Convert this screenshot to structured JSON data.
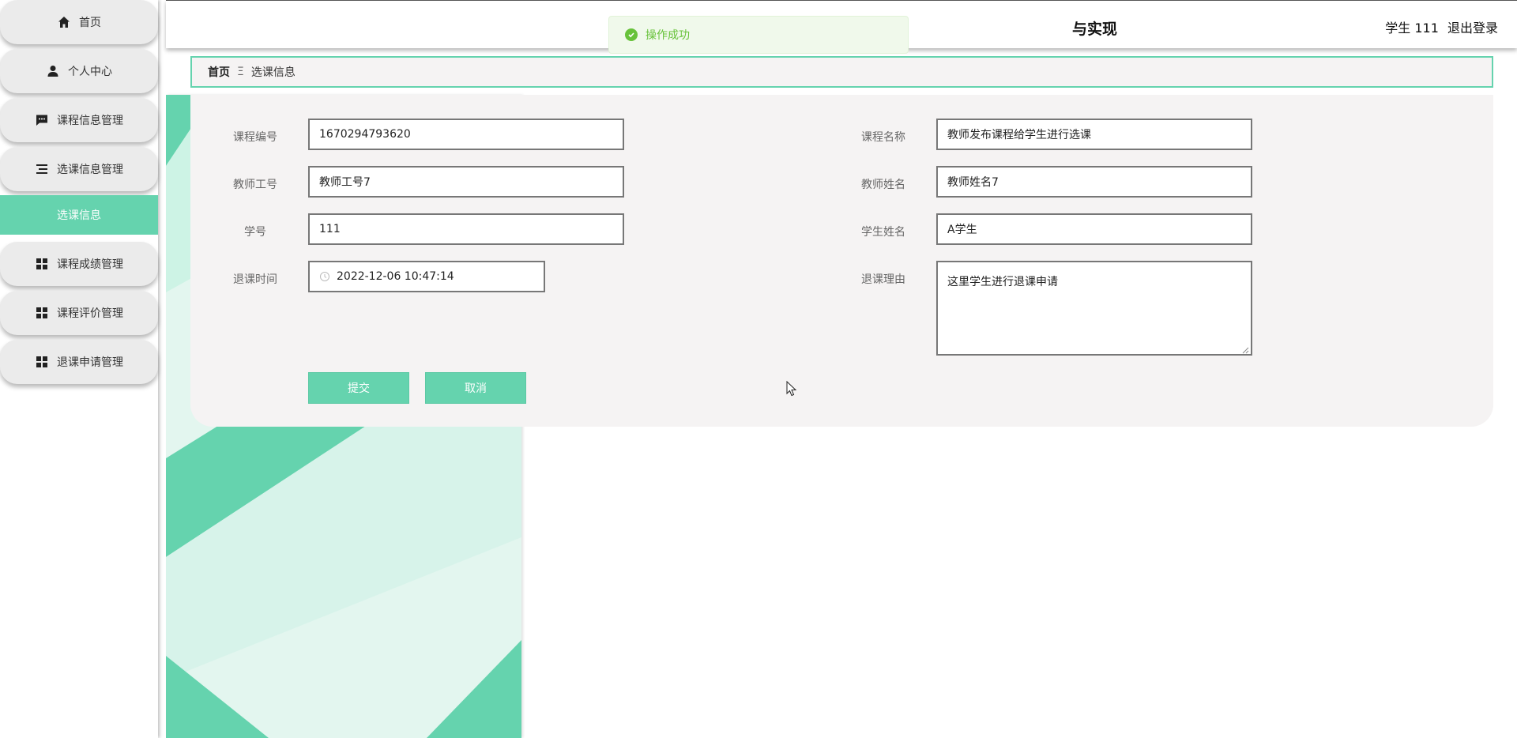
{
  "sidebar": {
    "items": [
      {
        "label": "首页",
        "icon": "home-icon"
      },
      {
        "label": "个人中心",
        "icon": "user-icon"
      },
      {
        "label": "课程信息管理",
        "icon": "chat-icon"
      },
      {
        "label": "选课信息管理",
        "icon": "list-icon"
      },
      {
        "label": "课程成绩管理",
        "icon": "grid-icon"
      },
      {
        "label": "课程评价管理",
        "icon": "grid-icon"
      },
      {
        "label": "退课申请管理",
        "icon": "grid-icon"
      }
    ],
    "active_sub": "选课信息",
    "accent_color": "#65d3ae"
  },
  "header": {
    "title_fragment": "与实现",
    "user_label": "学生 111",
    "logout": "退出登录"
  },
  "toast": {
    "message": "操作成功",
    "color": "#67c23a"
  },
  "breadcrumb": {
    "home": "首页",
    "separator": "Ξ",
    "current": "选课信息"
  },
  "form": {
    "course_no": {
      "label": "课程编号",
      "value": "1670294793620"
    },
    "course_name": {
      "label": "课程名称",
      "value": "教师发布课程给学生进行选课"
    },
    "teacher_no": {
      "label": "教师工号",
      "value": "教师工号7"
    },
    "teacher_name": {
      "label": "教师姓名",
      "value": "教师姓名7"
    },
    "student_no": {
      "label": "学号",
      "value": "111"
    },
    "student_name": {
      "label": "学生姓名",
      "value": "A学生"
    },
    "drop_time": {
      "label": "退课时间",
      "value": "2022-12-06 10:47:14"
    },
    "drop_reason": {
      "label": "退课理由",
      "value": "这里学生进行退课申请"
    },
    "submit": "提交",
    "cancel": "取消"
  }
}
